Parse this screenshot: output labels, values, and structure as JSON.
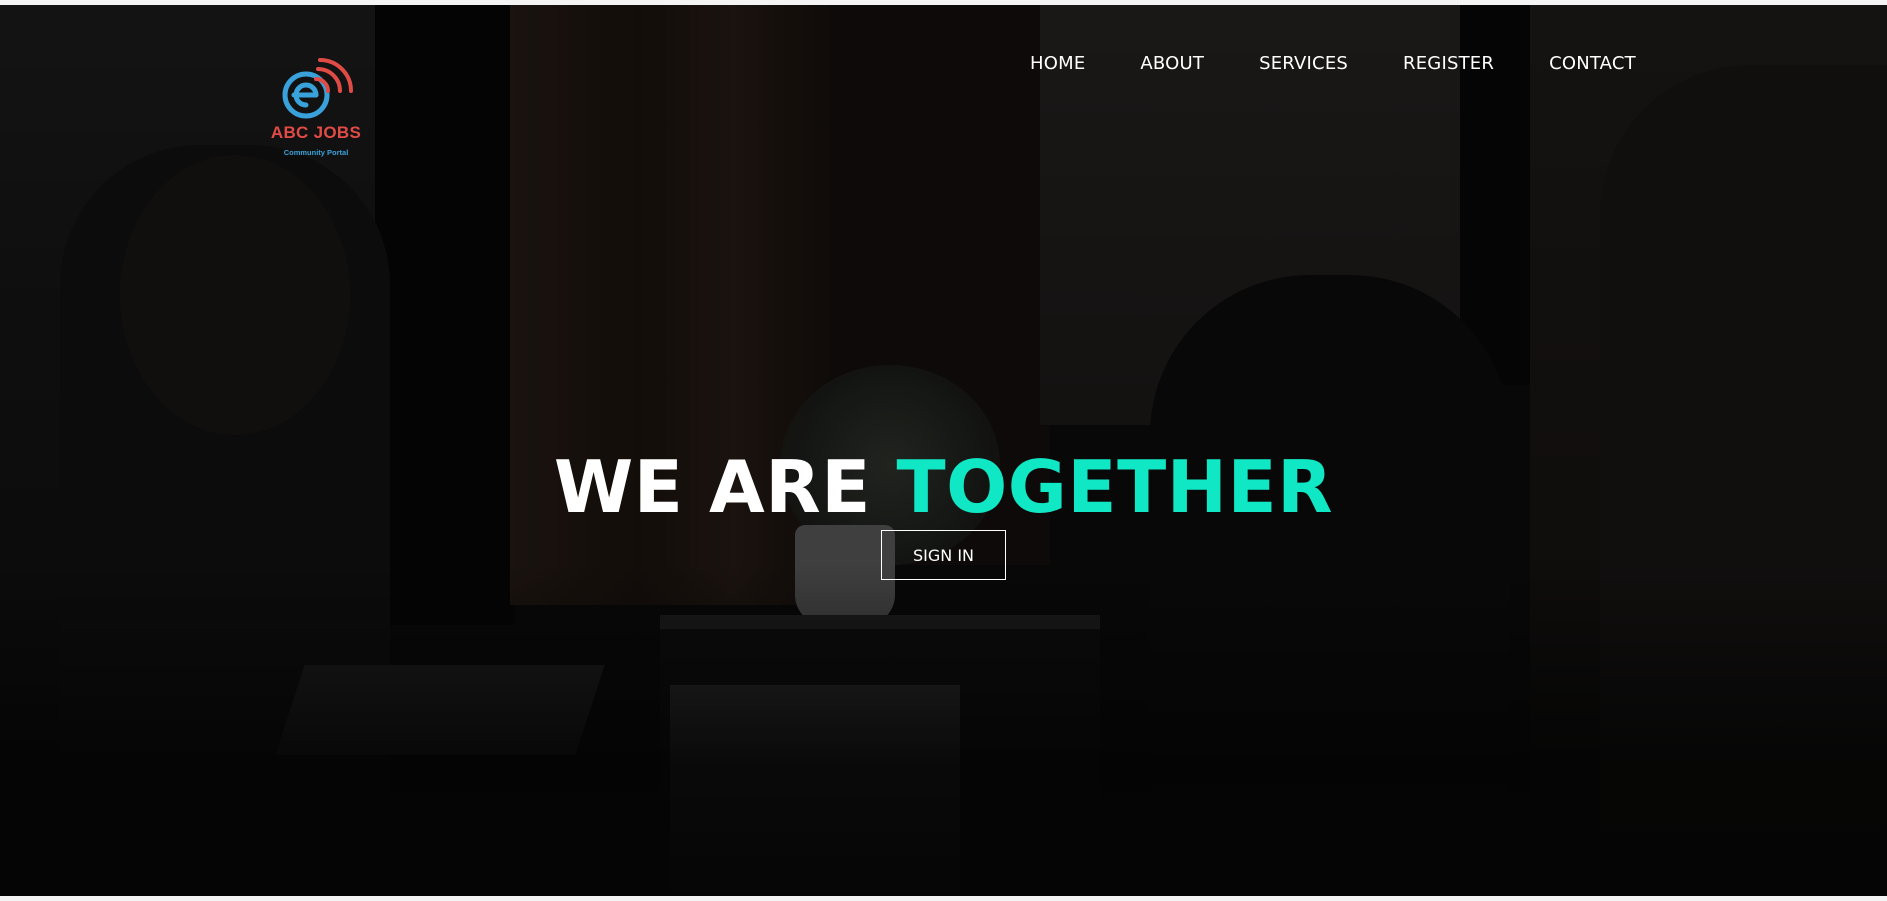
{
  "brand": {
    "logo_title": "ABC JOBS",
    "logo_subtitle": "Community Portal",
    "logo_colors": {
      "title": "#e04b46",
      "subtitle": "#3aa2db",
      "icon_ring": "#3aa2db",
      "icon_signal": "#e04b46"
    }
  },
  "nav": {
    "items": [
      {
        "label": "HOME"
      },
      {
        "label": "ABOUT"
      },
      {
        "label": "SERVICES"
      },
      {
        "label": "REGISTER"
      },
      {
        "label": "CONTACT"
      }
    ]
  },
  "hero": {
    "title_plain": "WE ARE",
    "title_accent": "TOGETHER",
    "accent_color": "#10e8c5",
    "cta_label": "SIGN IN",
    "background": "dark photo of people working on laptops"
  }
}
